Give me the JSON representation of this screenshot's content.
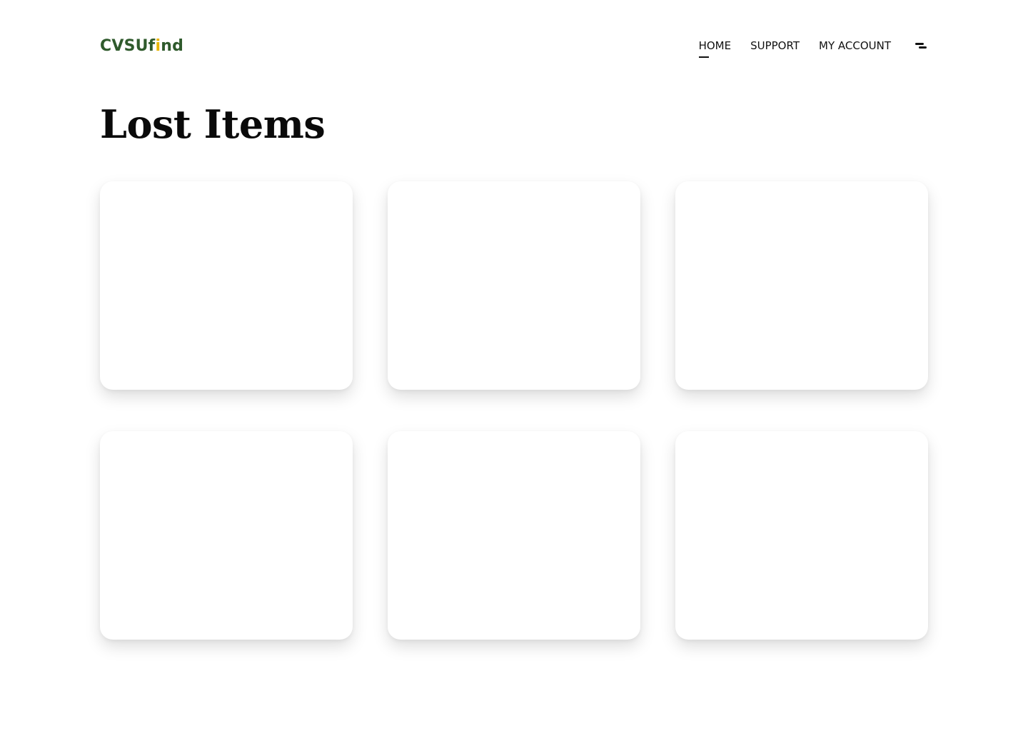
{
  "logo": {
    "part1": "CVSUf",
    "accent": "i",
    "part2": "nd",
    "primary_color": "#2f5a2c",
    "accent_color": "#e8b400"
  },
  "nav": {
    "items": [
      {
        "label": "HOME",
        "active": true
      },
      {
        "label": "SUPPORT",
        "active": false
      },
      {
        "label": "MY ACCOUNT",
        "active": false
      }
    ],
    "menu_icon": "menu-icon"
  },
  "main": {
    "title": "Lost Items",
    "cards": [
      {
        "id": 1
      },
      {
        "id": 2
      },
      {
        "id": 3
      },
      {
        "id": 4
      },
      {
        "id": 5
      },
      {
        "id": 6
      }
    ]
  }
}
